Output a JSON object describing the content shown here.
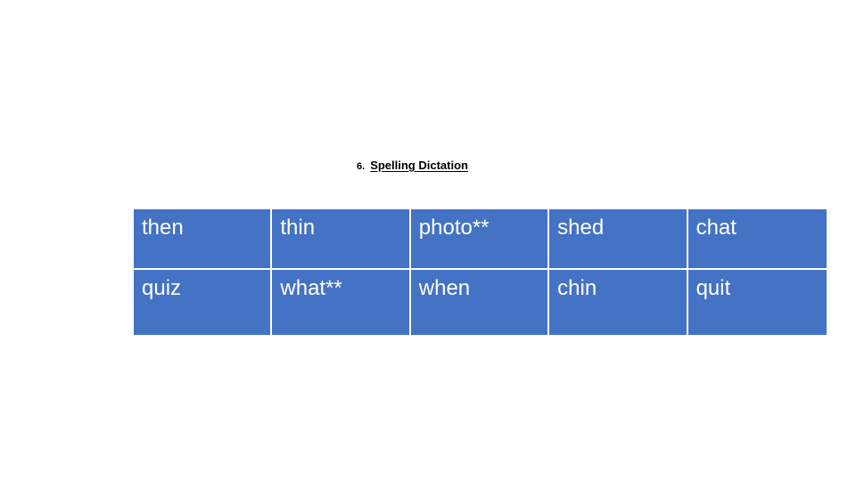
{
  "slide": {
    "background_color": "#ffffff",
    "heading": {
      "number": "6.",
      "title": "Spelling Dictation"
    },
    "table": {
      "fill_color": "#4472C4",
      "text_color": "#ffffff",
      "gridline_color": "#ffffff",
      "rows": [
        {
          "cells": [
            "then",
            "thin",
            "photo**",
            "shed",
            "chat"
          ]
        },
        {
          "cells": [
            "quiz",
            "what**",
            "when",
            "chin",
            "quit"
          ]
        }
      ]
    }
  }
}
